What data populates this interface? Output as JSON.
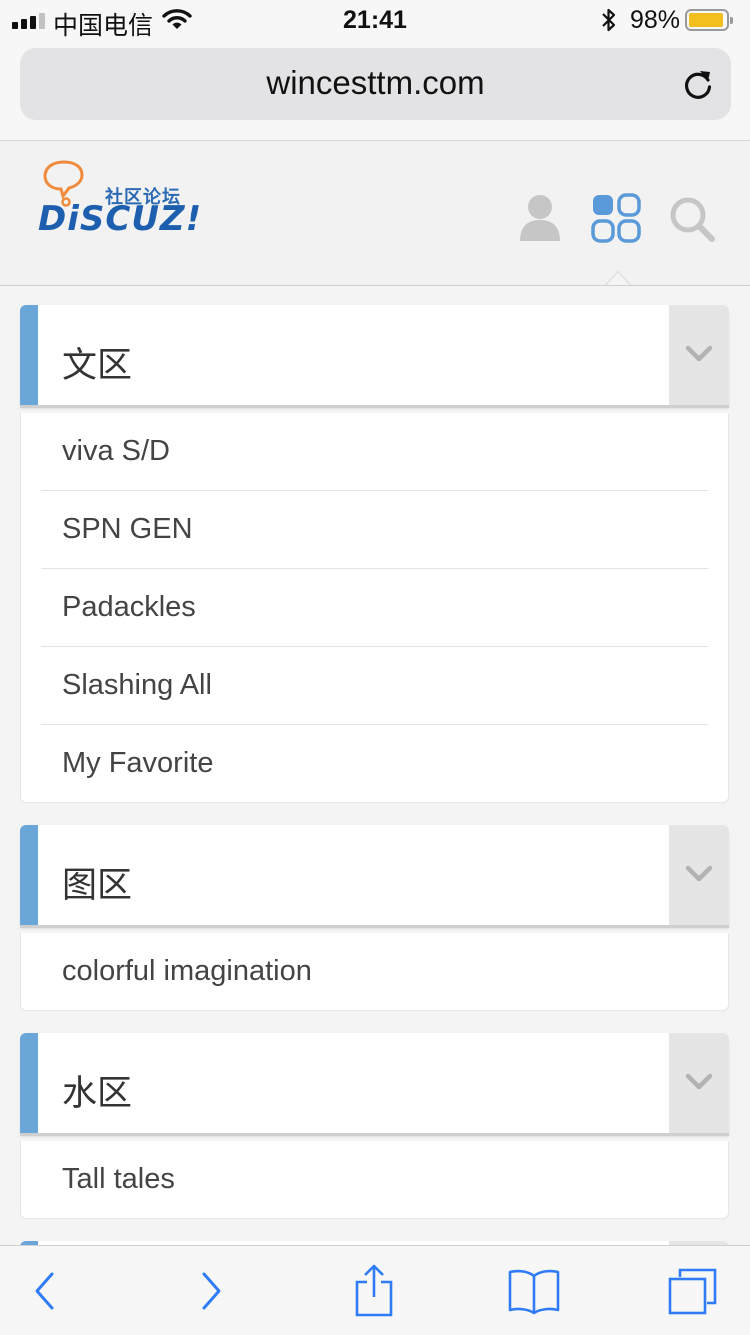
{
  "status_bar": {
    "carrier": "中国电信",
    "time": "21:41",
    "battery_percent": "98%"
  },
  "browser": {
    "url": "wincesttm.com"
  },
  "site": {
    "logo_sub": "社区论坛",
    "logo_main": "DiSCUZ!"
  },
  "sections": [
    {
      "title": "文区",
      "items": [
        "viva S/D",
        "SPN GEN",
        "Padackles",
        "Slashing All",
        "My Favorite"
      ]
    },
    {
      "title": "图区",
      "items": [
        "colorful imagination"
      ]
    },
    {
      "title": "水区",
      "items": [
        "Tall tales"
      ]
    }
  ],
  "colors": {
    "section_accent": "#6aa6d8",
    "ios_blue": "#2f7cf6",
    "header_icon_blue": "#5a9ad8",
    "header_icon_gray": "#c8c8c8"
  }
}
